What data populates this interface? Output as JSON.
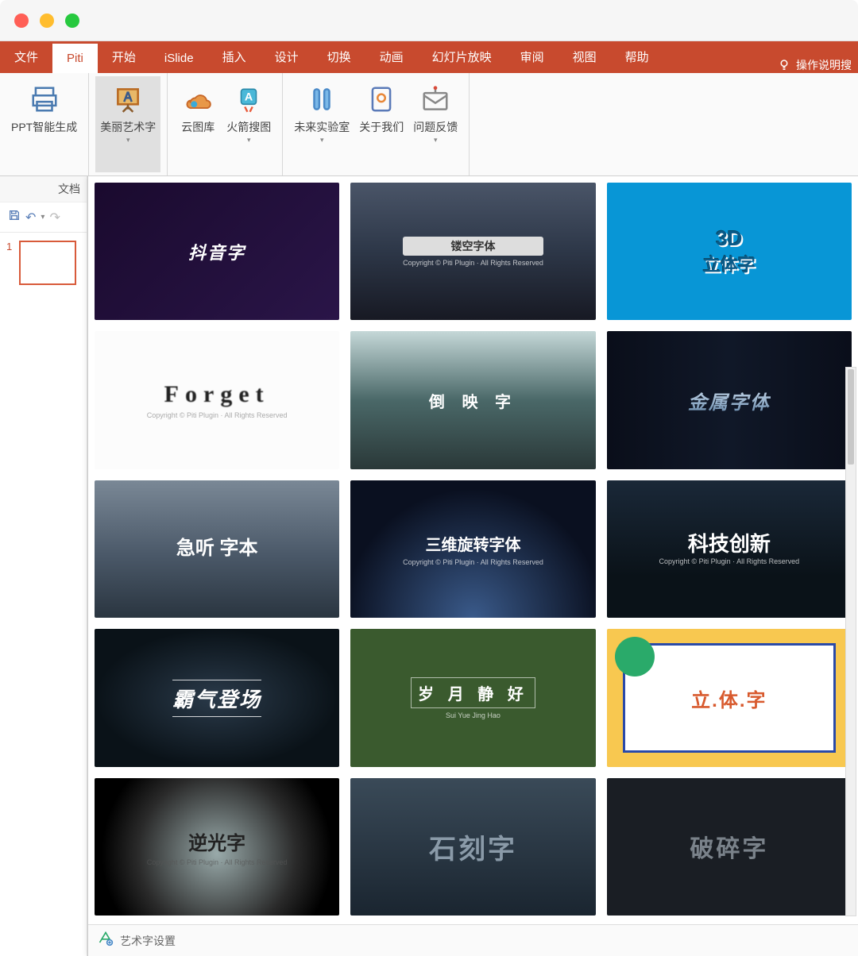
{
  "tabs": {
    "file": "文件",
    "piti": "Piti",
    "start": "开始",
    "islide": "iSlide",
    "insert": "插入",
    "design": "设计",
    "transition": "切换",
    "animation": "动画",
    "slideshow": "幻灯片放映",
    "review": "审阅",
    "view": "视图",
    "help": "帮助",
    "tellme": "操作说明搜"
  },
  "ribbon": {
    "ppt_gen": "PPT智能生成",
    "art_text": "美丽艺术字",
    "cloud_lib": "云图库",
    "rocket": "火箭搜图",
    "future_lab": "未来实验室",
    "about": "关于我们",
    "feedback": "问题反馈",
    "group_doc": "文档"
  },
  "slide": {
    "num": "1"
  },
  "gallery": {
    "items": [
      {
        "label": "抖音字"
      },
      {
        "label": "镂空字体"
      },
      {
        "label": "3D",
        "sub": "立体字"
      },
      {
        "label": "Forget"
      },
      {
        "label": "倒 映 字"
      },
      {
        "label": "金属字体"
      },
      {
        "label": "急听 字本"
      },
      {
        "label": "三维旋转字体"
      },
      {
        "label": "科技创新"
      },
      {
        "label": "霸气登场"
      },
      {
        "label": "岁 月 静 好",
        "sub": "Sui Yue Jing Hao"
      },
      {
        "label": "立.体.字"
      },
      {
        "label": "逆光字"
      },
      {
        "label": "石刻字"
      },
      {
        "label": "破碎字"
      }
    ],
    "footer": "艺术字设置"
  }
}
